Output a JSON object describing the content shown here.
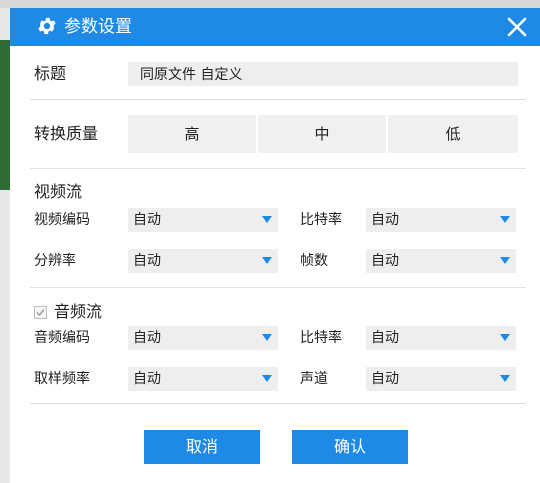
{
  "dialog": {
    "title": "参数设置",
    "icons": {
      "title": "gear-icon",
      "close": "close-icon",
      "dropdown": "chevron-down-icon",
      "checkbox": "checkmark-icon"
    },
    "accent_color": "#1e8ae6"
  },
  "form": {
    "title_label": "标题",
    "title_value": "同原文件 自定义"
  },
  "quality": {
    "label": "转换质量",
    "options": [
      "高",
      "中",
      "低"
    ]
  },
  "video": {
    "section_label": "视频流",
    "codec_label": "视频编码",
    "codec_value": "自动",
    "bitrate_label": "比特率",
    "bitrate_value": "自动",
    "resolution_label": "分辨率",
    "resolution_value": "自动",
    "fps_label": "帧数",
    "fps_value": "自动"
  },
  "audio": {
    "section_label": "音频流",
    "enabled": true,
    "codec_label": "音频编码",
    "codec_value": "自动",
    "bitrate_label": "比特率",
    "bitrate_value": "自动",
    "samplerate_label": "取样频率",
    "samplerate_value": "自动",
    "channel_label": "声道",
    "channel_value": "自动"
  },
  "buttons": {
    "cancel": "取消",
    "confirm": "确认"
  }
}
